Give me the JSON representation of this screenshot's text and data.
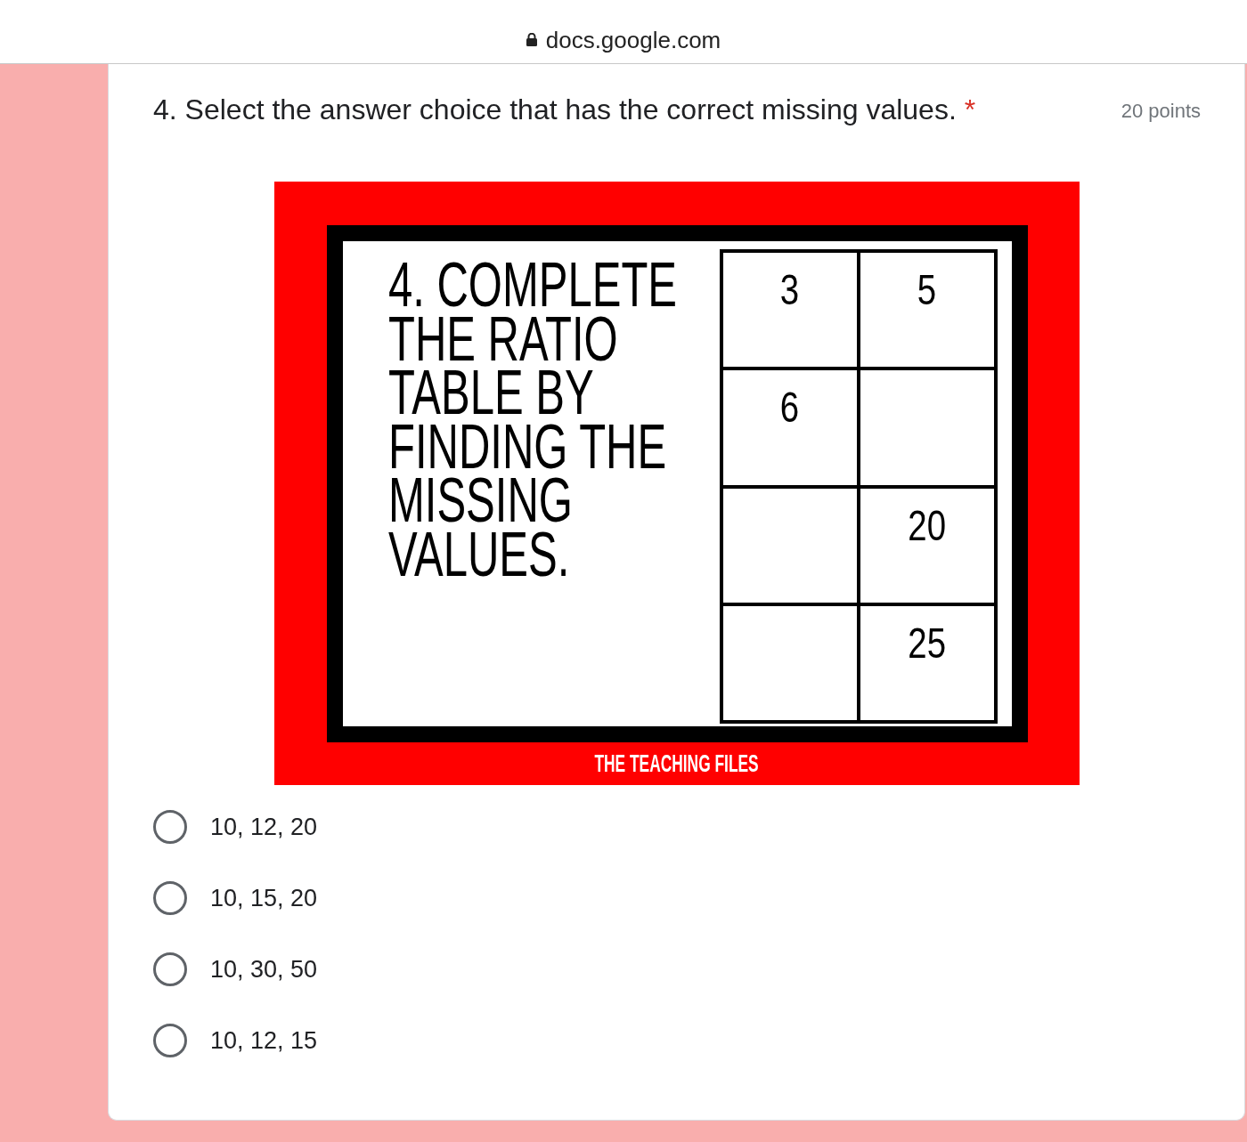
{
  "address_bar": {
    "url": "docs.google.com"
  },
  "question": {
    "title": "4. Select the answer choice that has the correct missing values.",
    "required_mark": "*",
    "points": "20 points",
    "image": {
      "prompt": "4. COMPLETE THE RATIO TABLE BY FINDING THE MISSING VALUES.",
      "table": {
        "rows": [
          {
            "column_1": "3",
            "column_2": "5"
          },
          {
            "column_1": "6"
          },
          {
            "column_2": "20"
          },
          {
            "column_2": "25"
          }
        ]
      },
      "credit": "THE TEACHING FILES"
    },
    "options": [
      {
        "label": "10, 12, 20",
        "selected": false
      },
      {
        "label": "10, 15, 20",
        "selected": false
      },
      {
        "label": "10, 30, 50",
        "selected": false
      },
      {
        "label": "10, 12, 15",
        "selected": false
      }
    ]
  }
}
